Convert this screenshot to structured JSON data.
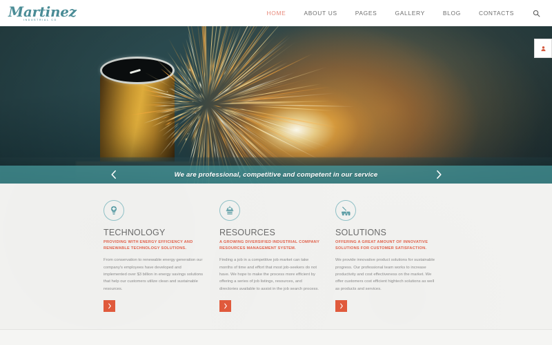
{
  "header": {
    "logo": {
      "word": "Martinez",
      "sub": "INDUSTRIAL CO"
    },
    "nav": [
      {
        "label": "HOME",
        "active": true
      },
      {
        "label": "ABOUT US",
        "active": false
      },
      {
        "label": "PAGES",
        "active": false
      },
      {
        "label": "GALLERY",
        "active": false
      },
      {
        "label": "BLOG",
        "active": false
      },
      {
        "label": "CONTACTS",
        "active": false
      }
    ],
    "search_icon": "search-icon",
    "accent_color": "#e8897b",
    "nav_color": "#6d6d6d"
  },
  "hero": {
    "caption": "We are professional, competitive and competent in our service",
    "prev_arrow": "‹",
    "next_arrow": "›",
    "side_tab_icon": "user-icon",
    "caption_bar_color": "#489ca0"
  },
  "features": {
    "items": [
      {
        "icon": "gear-bulb-icon",
        "title": "TECHNOLOGY",
        "subtitle": "PROVIDING WITH ENERGY EFFICIENCY AND RENEWABLE TECHNOLOGY SOLUTIONS.",
        "body": "From conservation to renewable energy generation our company's employees have developed and implemented over $3 billion in energy savings solutions that help our customers utilize clean and sustainable resources.",
        "button_icon": "›"
      },
      {
        "icon": "worker-helmet-icon",
        "title": "RESOURCES",
        "subtitle": "A GROWING DIVERSIFIED INDUSTRIAL COMPANY RESOURCES MANAGEMENT SYSTEM.",
        "body": "Finding a job in a competitive job market can take months of time and effort that most job-seekers do not have. We hope to make the process more efficient by offering a series of job listings, resources, and directories available to assist in the job search process.",
        "button_icon": "›"
      },
      {
        "icon": "excavator-icon",
        "title": "SOLUTIONS",
        "subtitle": "OFFERING A GREAT AMOUNT OF INNOVATIVE SOLUTIONS FOR CUSTOMER SATISFACTION.",
        "body": "We provide innovative product solutions for sustainable progress. Our professional team works to increase productivity and cost effectiveness on the market. We offer customers cost efficient hightech solutions as well as products and services.",
        "button_icon": "›"
      }
    ],
    "accent_color": "#e0604a",
    "icon_ring_color": "#8fc0c6",
    "button_color": "#e05a3c"
  }
}
